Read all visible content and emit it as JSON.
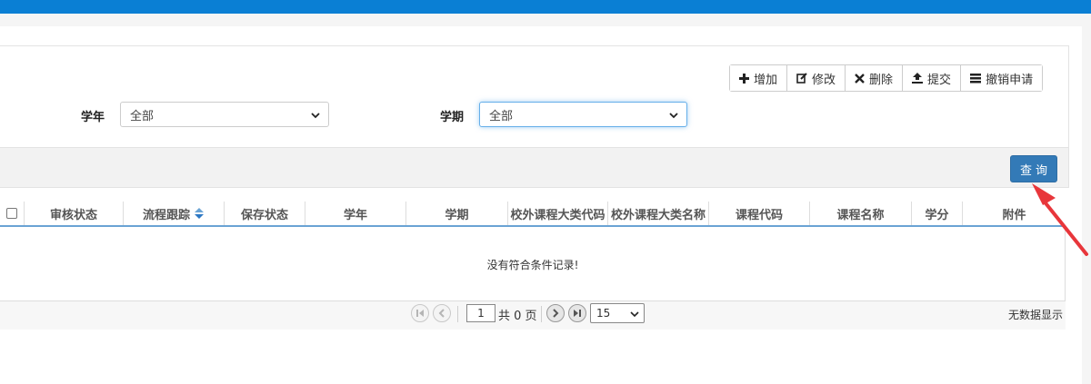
{
  "toolbar": {
    "items": [
      {
        "label": "增加",
        "icon": "plus-icon"
      },
      {
        "label": "修改",
        "icon": "edit-icon"
      },
      {
        "label": "删除",
        "icon": "close-icon"
      },
      {
        "label": "提交",
        "icon": "upload-icon"
      },
      {
        "label": "撤销申请",
        "icon": "list-icon"
      }
    ]
  },
  "filters": {
    "year_label": "学年",
    "year_value": "全部",
    "term_label": "学期",
    "term_value": "全部"
  },
  "query_button": "查询",
  "table": {
    "columns": [
      "审核状态",
      "流程跟踪",
      "保存状态",
      "学年",
      "学期",
      "校外课程大类代码",
      "校外课程大类名称",
      "课程代码",
      "课程名称",
      "学分",
      "附件"
    ],
    "empty_message": "没有符合条件记录!"
  },
  "pager": {
    "current_page": "1",
    "total_text": "共 0 页",
    "page_size": "15",
    "no_data": "无数据显示"
  },
  "colors": {
    "topbar": "#0a7fd4",
    "primary_button": "#337ab7",
    "annotation_arrow": "#e8363b"
  }
}
